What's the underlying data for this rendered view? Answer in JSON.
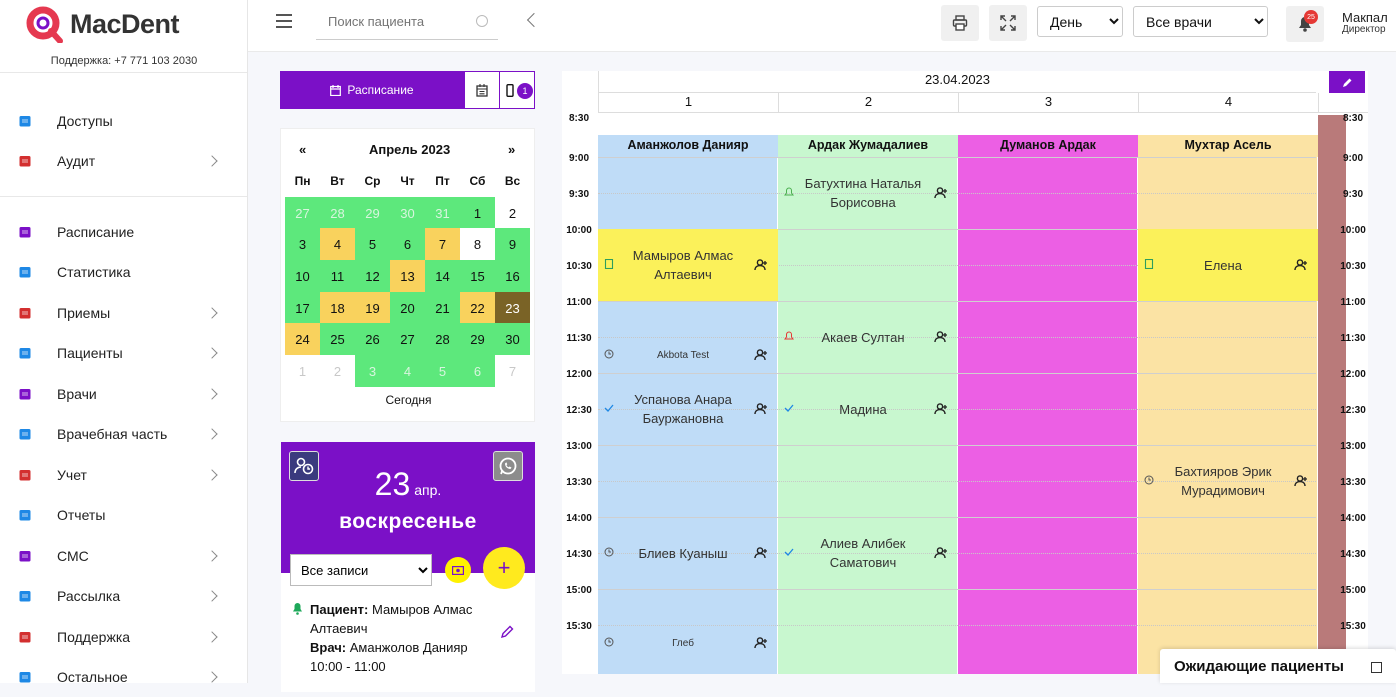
{
  "brand": {
    "name": "MacDent",
    "support": "Поддержка: +7 771 103 2030",
    "accent": "#7b10c7"
  },
  "nav": [
    {
      "label": "Доступы",
      "icon": "gear-icon",
      "color": "#1e88e5",
      "chevron": false
    },
    {
      "label": "Аудит",
      "icon": "audit-icon",
      "color": "#d32f2f",
      "chevron": true
    },
    {
      "label": "Расписание",
      "icon": "calendar-icon",
      "color": "#7b10c7",
      "chevron": false
    },
    {
      "label": "Статистика",
      "icon": "chart-line-icon",
      "color": "#1e88e5",
      "chevron": false
    },
    {
      "label": "Приемы",
      "icon": "calendar-check-icon",
      "color": "#d32f2f",
      "chevron": true
    },
    {
      "label": "Пациенты",
      "icon": "users-icon",
      "color": "#1e88e5",
      "chevron": true
    },
    {
      "label": "Врачи",
      "icon": "doctor-icon",
      "color": "#7b10c7",
      "chevron": true
    },
    {
      "label": "Врачебная часть",
      "icon": "medkit-icon",
      "color": "#1e88e5",
      "chevron": true
    },
    {
      "label": "Учет",
      "icon": "ledger-icon",
      "color": "#d32f2f",
      "chevron": true
    },
    {
      "label": "Отчеты",
      "icon": "report-icon",
      "color": "#1e88e5",
      "chevron": false
    },
    {
      "label": "СМС",
      "icon": "sms-icon",
      "color": "#7b10c7",
      "chevron": true
    },
    {
      "label": "Рассылка",
      "icon": "mailing-icon",
      "color": "#1e88e5",
      "chevron": true
    },
    {
      "label": "Поддержка",
      "icon": "question-icon",
      "color": "#d32f2f",
      "chevron": true
    },
    {
      "label": "Остальное",
      "icon": "more-icon",
      "color": "#1e88e5",
      "chevron": true
    }
  ],
  "topbar": {
    "search_placeholder": "Поиск пациента",
    "view_value": "День",
    "doctor_filter": "Все врачи",
    "notifications": "25",
    "user_name": "Макпал",
    "user_role": "Директор"
  },
  "mid": {
    "schedule_btn": "Расписание",
    "phone_badge": "1",
    "calendar": {
      "prev": "«",
      "next": "»",
      "month": "Апрель 2023",
      "dow": [
        "Пн",
        "Вт",
        "Ср",
        "Чт",
        "Пт",
        "Сб",
        "Вс"
      ],
      "weeks": [
        [
          {
            "d": "27",
            "s": "o"
          },
          {
            "d": "28",
            "s": "o"
          },
          {
            "d": "29",
            "s": "o"
          },
          {
            "d": "30",
            "s": "o"
          },
          {
            "d": "31",
            "s": "o"
          },
          {
            "d": "1",
            "s": "g"
          },
          {
            "d": "2",
            "s": "w"
          }
        ],
        [
          {
            "d": "3",
            "s": "g"
          },
          {
            "d": "4",
            "s": "y"
          },
          {
            "d": "5",
            "s": "g"
          },
          {
            "d": "6",
            "s": "g"
          },
          {
            "d": "7",
            "s": "y"
          },
          {
            "d": "8",
            "s": "w"
          },
          {
            "d": "9",
            "s": "g"
          }
        ],
        [
          {
            "d": "10",
            "s": "g"
          },
          {
            "d": "11",
            "s": "g"
          },
          {
            "d": "12",
            "s": "g"
          },
          {
            "d": "13",
            "s": "y"
          },
          {
            "d": "14",
            "s": "g"
          },
          {
            "d": "15",
            "s": "g"
          },
          {
            "d": "16",
            "s": "g"
          }
        ],
        [
          {
            "d": "17",
            "s": "g"
          },
          {
            "d": "18",
            "s": "y"
          },
          {
            "d": "19",
            "s": "y"
          },
          {
            "d": "20",
            "s": "g"
          },
          {
            "d": "21",
            "s": "g"
          },
          {
            "d": "22",
            "s": "y"
          },
          {
            "d": "23",
            "s": "sel"
          }
        ],
        [
          {
            "d": "24",
            "s": "y"
          },
          {
            "d": "25",
            "s": "g"
          },
          {
            "d": "26",
            "s": "g"
          },
          {
            "d": "27",
            "s": "g"
          },
          {
            "d": "28",
            "s": "g"
          },
          {
            "d": "29",
            "s": "g"
          },
          {
            "d": "30",
            "s": "g"
          }
        ],
        [
          {
            "d": "1",
            "s": "n"
          },
          {
            "d": "2",
            "s": "n"
          },
          {
            "d": "3",
            "s": "o"
          },
          {
            "d": "4",
            "s": "o"
          },
          {
            "d": "5",
            "s": "o"
          },
          {
            "d": "6",
            "s": "o"
          },
          {
            "d": "7",
            "s": "n"
          }
        ]
      ],
      "today": "Сегодня"
    },
    "card": {
      "day_num": "23",
      "month_abbr": "апр.",
      "weekday": "воскресенье",
      "filter": "Все записи",
      "patient_label": "Пациент:",
      "patient_name": "Мамыров Алмас Алтаевич",
      "doctor_label": "Врач:",
      "doctor_name": "Аманжолов Данияр",
      "time": "10:00 - 11:00"
    }
  },
  "grid": {
    "date": "23.04.2023",
    "columns": [
      "1",
      "2",
      "3",
      "4"
    ],
    "times": [
      "8:30",
      "9:00",
      "9:30",
      "10:00",
      "10:30",
      "11:00",
      "11:30",
      "12:00",
      "12:30",
      "13:00",
      "13:30",
      "14:00",
      "14:30",
      "15:00",
      "15:30"
    ],
    "doctors": [
      {
        "name": "Аманжолов Данияр",
        "bg": "#bfdcf7",
        "hdr": "#bfdcf7"
      },
      {
        "name": "Ардак Жумадалиев",
        "bg": "#c8f7cf",
        "hdr": "#c8f7cf"
      },
      {
        "name": "Думанов Ардак",
        "bg": "#ec5fe4",
        "hdr": "#ec5fe4"
      },
      {
        "name": "Мухтар Асель",
        "bg": "#fbe3a4",
        "hdr": "#fbe3a4"
      }
    ],
    "appointments": [
      {
        "col": 0,
        "start": 3,
        "len": 2,
        "text": "Мамыров Алмас Алтаевич",
        "bg": "#fbf15a",
        "lic": "card-icon",
        "size": 13
      },
      {
        "col": 0,
        "start": 6,
        "len": 1,
        "text": "Akbota Test",
        "bg": "",
        "lic": "clock-icon",
        "size": 10
      },
      {
        "col": 0,
        "start": 7,
        "len": 2,
        "text": "Успанова Анара Бауржановна",
        "bg": "",
        "lic": "check-icon",
        "size": 13
      },
      {
        "col": 0,
        "start": 11,
        "len": 2,
        "text": "Блиев Куаныш",
        "bg": "",
        "lic": "clock-icon",
        "size": 13
      },
      {
        "col": 0,
        "start": 14,
        "len": 1,
        "text": "Глеб",
        "bg": "",
        "lic": "clock-icon",
        "size": 10
      },
      {
        "col": 1,
        "start": 1,
        "len": 2,
        "text": "Батухтина Наталья Борисовна",
        "bg": "",
        "lic": "bell-icon",
        "size": 13
      },
      {
        "col": 1,
        "start": 5,
        "len": 2,
        "text": "Акаев Султан",
        "bg": "",
        "lic": "bell-red-icon",
        "size": 13
      },
      {
        "col": 1,
        "start": 7,
        "len": 2,
        "text": "Мадина",
        "bg": "",
        "lic": "check-icon",
        "size": 13
      },
      {
        "col": 1,
        "start": 11,
        "len": 2,
        "text": "Алиев Алибек Саматович",
        "bg": "",
        "lic": "check-icon",
        "size": 13
      },
      {
        "col": 3,
        "start": 3,
        "len": 2,
        "text": "Елена",
        "bg": "#fbf15a",
        "lic": "card-icon",
        "size": 13
      },
      {
        "col": 3,
        "start": 9,
        "len": 2,
        "text": "Бахтияров Эрик Мурадимович",
        "bg": "",
        "lic": "clock-icon",
        "size": 13
      }
    ]
  },
  "waiting": "Ожидающие пациенты"
}
